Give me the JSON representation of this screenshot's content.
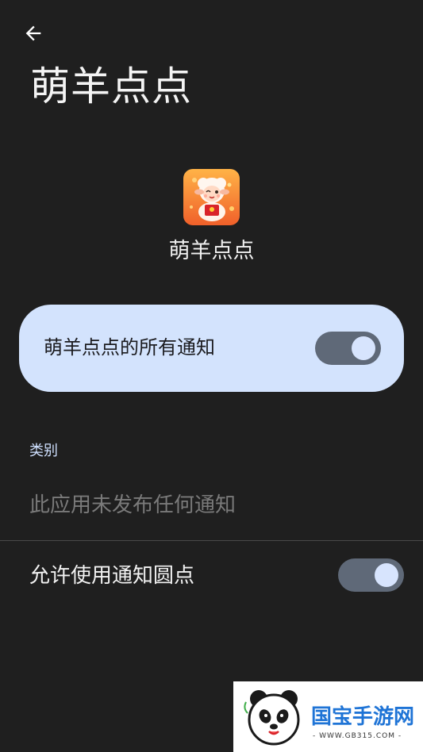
{
  "header": {
    "back_icon": "arrow-left-icon",
    "title": "萌羊点点"
  },
  "app": {
    "icon": "sheep-app-icon",
    "name": "萌羊点点"
  },
  "all_notifications": {
    "label": "萌羊点点的所有通知",
    "enabled": true
  },
  "categories": {
    "header": "类别",
    "empty_text": "此应用未发布任何通知"
  },
  "notification_dot": {
    "label": "允许使用通知圆点",
    "enabled": true
  },
  "watermark": {
    "brand_text": "国宝手游网",
    "url_text": "- WWW.GB315.COM -",
    "icon": "panda-logo-icon"
  },
  "colors": {
    "background": "#1f1f1f",
    "card": "#d3e3fd",
    "toggle_track": "#5f6978",
    "toggle_knob": "#d7e4fd",
    "section_header": "#cfe0ff",
    "muted_text": "#7a7a7a"
  }
}
